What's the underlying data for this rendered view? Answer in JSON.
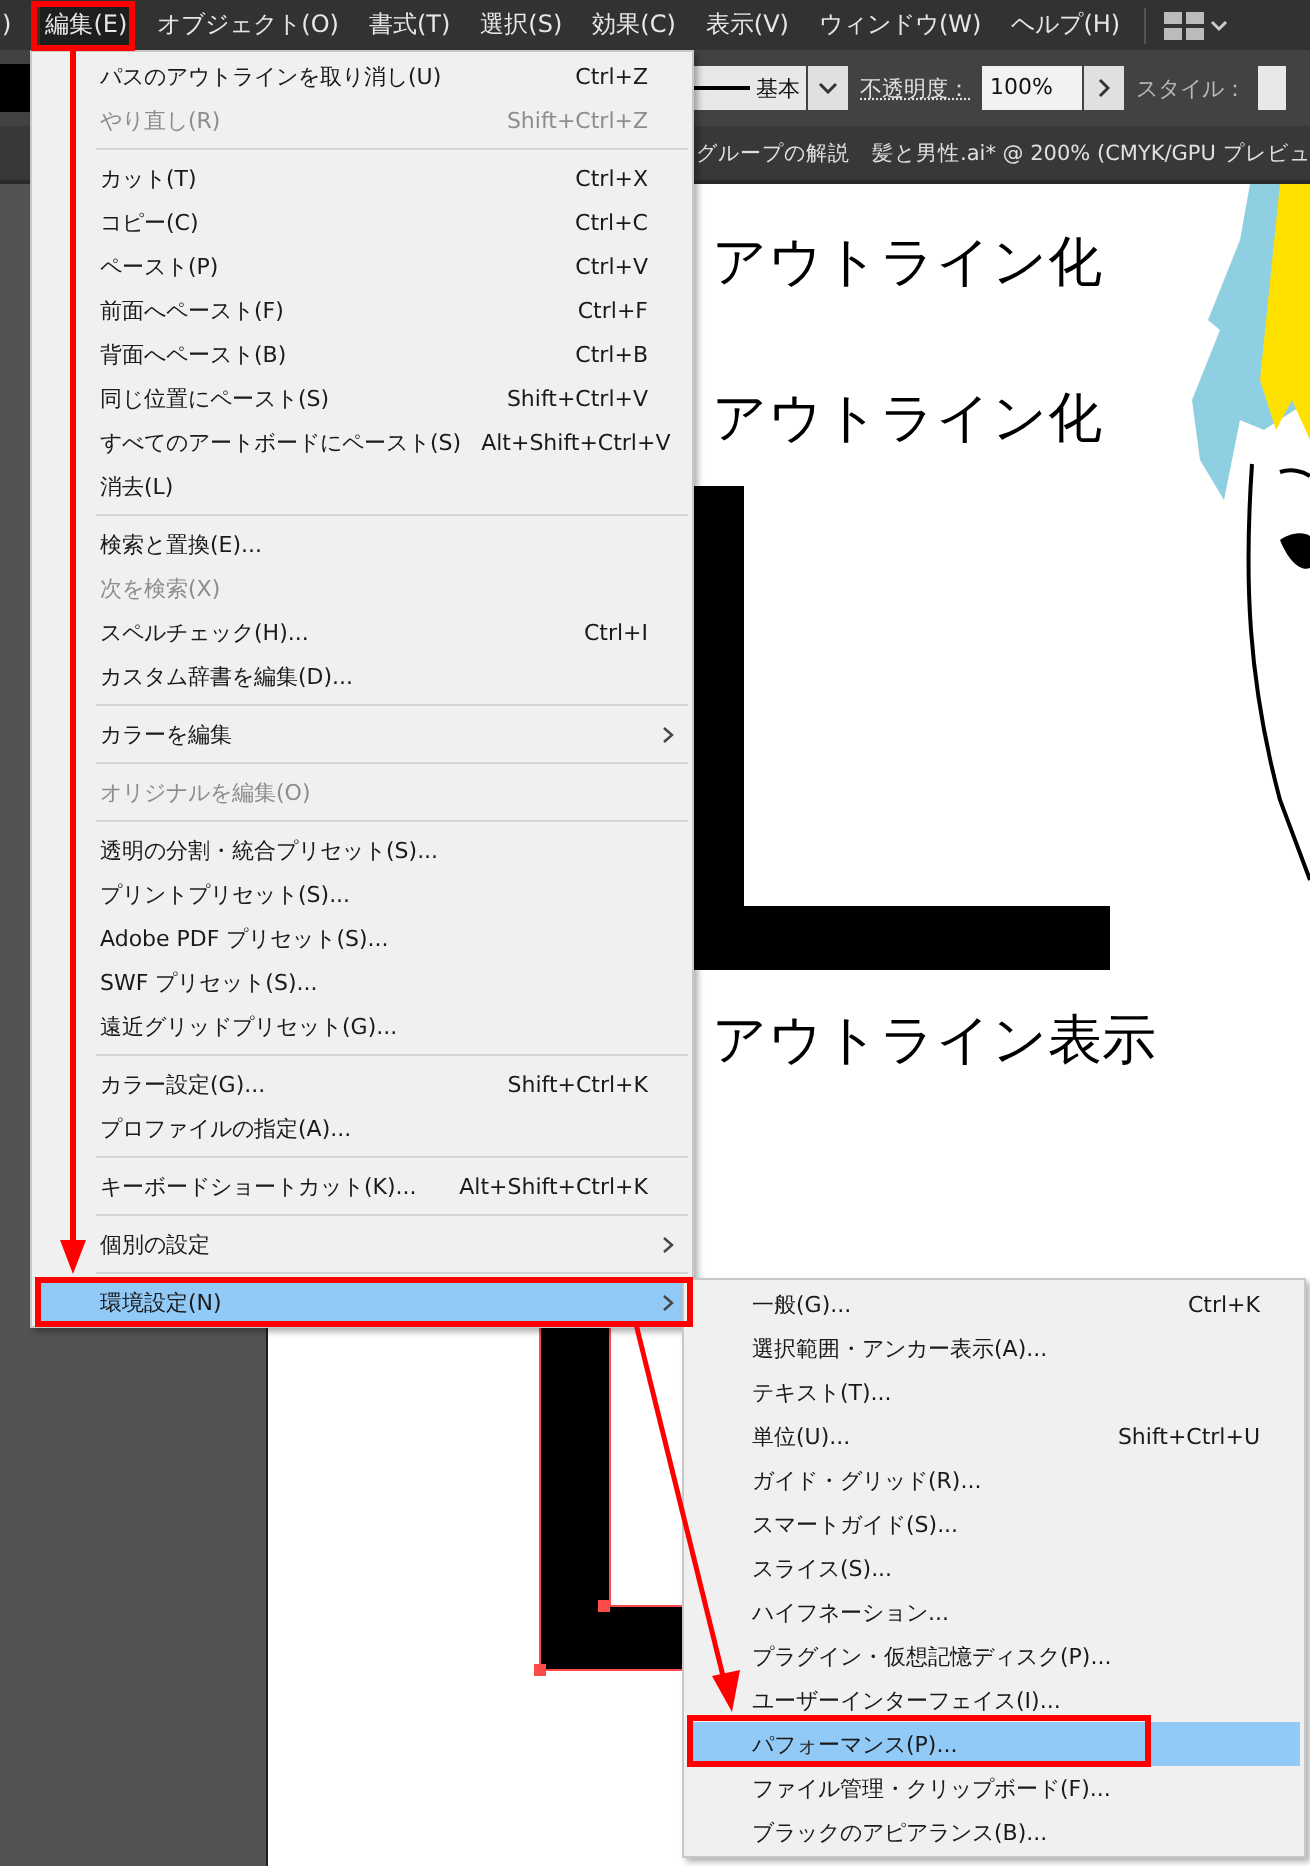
{
  "menu_bar": {
    "items": [
      {
        "label": ")",
        "selected": false
      },
      {
        "label": "編集(E)",
        "selected": true
      },
      {
        "label": "オブジェクト(O)",
        "selected": false
      },
      {
        "label": "書式(T)",
        "selected": false
      },
      {
        "label": "選択(S)",
        "selected": false
      },
      {
        "label": "効果(C)",
        "selected": false
      },
      {
        "label": "表示(V)",
        "selected": false
      },
      {
        "label": "ウィンドウ(W)",
        "selected": false
      },
      {
        "label": "ヘルプ(H)",
        "selected": false
      }
    ]
  },
  "control_bar": {
    "stroke_style": "基本",
    "opacity_label": "不透明度：",
    "opacity_value": "100%",
    "style_label": "スタイル："
  },
  "document_tab": {
    "title": "グループの解説　髪と男性.ai* @ 200% (CMYK/GPU プレビュ"
  },
  "canvas": {
    "texts": [
      "アウトライン化",
      "アウトライン化",
      "アウトライン表示"
    ]
  },
  "edit_menu": {
    "items": [
      {
        "kind": "item",
        "label": "パスのアウトラインを取り消し(U)",
        "shortcut": "Ctrl+Z",
        "disabled": false,
        "has_submenu": false,
        "selected": false
      },
      {
        "kind": "item",
        "label": "やり直し(R)",
        "shortcut": "Shift+Ctrl+Z",
        "disabled": true,
        "has_submenu": false,
        "selected": false
      },
      {
        "kind": "separator"
      },
      {
        "kind": "item",
        "label": "カット(T)",
        "shortcut": "Ctrl+X",
        "disabled": false,
        "has_submenu": false,
        "selected": false
      },
      {
        "kind": "item",
        "label": "コピー(C)",
        "shortcut": "Ctrl+C",
        "disabled": false,
        "has_submenu": false,
        "selected": false
      },
      {
        "kind": "item",
        "label": "ペースト(P)",
        "shortcut": "Ctrl+V",
        "disabled": false,
        "has_submenu": false,
        "selected": false
      },
      {
        "kind": "item",
        "label": "前面へペースト(F)",
        "shortcut": "Ctrl+F",
        "disabled": false,
        "has_submenu": false,
        "selected": false
      },
      {
        "kind": "item",
        "label": "背面へペースト(B)",
        "shortcut": "Ctrl+B",
        "disabled": false,
        "has_submenu": false,
        "selected": false
      },
      {
        "kind": "item",
        "label": "同じ位置にペースト(S)",
        "shortcut": "Shift+Ctrl+V",
        "disabled": false,
        "has_submenu": false,
        "selected": false
      },
      {
        "kind": "item",
        "label": "すべてのアートボードにペースト(S)",
        "shortcut": "Alt+Shift+Ctrl+V",
        "disabled": false,
        "has_submenu": false,
        "selected": false
      },
      {
        "kind": "item",
        "label": "消去(L)",
        "disabled": false,
        "has_submenu": false,
        "selected": false
      },
      {
        "kind": "separator"
      },
      {
        "kind": "item",
        "label": "検索と置換(E)...",
        "disabled": false,
        "has_submenu": false,
        "selected": false
      },
      {
        "kind": "item",
        "label": "次を検索(X)",
        "disabled": true,
        "has_submenu": false,
        "selected": false
      },
      {
        "kind": "item",
        "label": "スペルチェック(H)...",
        "shortcut": "Ctrl+I",
        "disabled": false,
        "has_submenu": false,
        "selected": false
      },
      {
        "kind": "item",
        "label": "カスタム辞書を編集(D)...",
        "disabled": false,
        "has_submenu": false,
        "selected": false
      },
      {
        "kind": "separator"
      },
      {
        "kind": "item",
        "label": "カラーを編集",
        "disabled": false,
        "has_submenu": true,
        "selected": false
      },
      {
        "kind": "separator"
      },
      {
        "kind": "item",
        "label": "オリジナルを編集(O)",
        "disabled": true,
        "has_submenu": false,
        "selected": false
      },
      {
        "kind": "separator"
      },
      {
        "kind": "item",
        "label": "透明の分割・統合プリセット(S)...",
        "disabled": false,
        "has_submenu": false,
        "selected": false
      },
      {
        "kind": "item",
        "label": "プリントプリセット(S)...",
        "disabled": false,
        "has_submenu": false,
        "selected": false
      },
      {
        "kind": "item",
        "label": "Adobe PDF プリセット(S)...",
        "disabled": false,
        "has_submenu": false,
        "selected": false
      },
      {
        "kind": "item",
        "label": "SWF プリセット(S)...",
        "disabled": false,
        "has_submenu": false,
        "selected": false
      },
      {
        "kind": "item",
        "label": "遠近グリッドプリセット(G)...",
        "disabled": false,
        "has_submenu": false,
        "selected": false
      },
      {
        "kind": "separator"
      },
      {
        "kind": "item",
        "label": "カラー設定(G)...",
        "shortcut": "Shift+Ctrl+K",
        "disabled": false,
        "has_submenu": false,
        "selected": false
      },
      {
        "kind": "item",
        "label": "プロファイルの指定(A)...",
        "disabled": false,
        "has_submenu": false,
        "selected": false
      },
      {
        "kind": "separator"
      },
      {
        "kind": "item",
        "label": "キーボードショートカット(K)...",
        "shortcut": "Alt+Shift+Ctrl+K",
        "disabled": false,
        "has_submenu": false,
        "selected": false
      },
      {
        "kind": "separator"
      },
      {
        "kind": "item",
        "label": "個別の設定",
        "disabled": false,
        "has_submenu": true,
        "selected": false
      },
      {
        "kind": "separator"
      },
      {
        "kind": "item",
        "label": "環境設定(N)",
        "disabled": false,
        "has_submenu": true,
        "selected": true
      }
    ]
  },
  "preferences_submenu": {
    "items": [
      {
        "kind": "item",
        "label": "一般(G)...",
        "shortcut": "Ctrl+K",
        "disabled": false,
        "has_submenu": false,
        "selected": false
      },
      {
        "kind": "item",
        "label": "選択範囲・アンカー表示(A)...",
        "disabled": false,
        "has_submenu": false,
        "selected": false
      },
      {
        "kind": "item",
        "label": "テキスト(T)...",
        "disabled": false,
        "has_submenu": false,
        "selected": false
      },
      {
        "kind": "item",
        "label": "単位(U)...",
        "shortcut": "Shift+Ctrl+U",
        "disabled": false,
        "has_submenu": false,
        "selected": false
      },
      {
        "kind": "item",
        "label": "ガイド・グリッド(R)...",
        "disabled": false,
        "has_submenu": false,
        "selected": false
      },
      {
        "kind": "item",
        "label": "スマートガイド(S)...",
        "disabled": false,
        "has_submenu": false,
        "selected": false
      },
      {
        "kind": "item",
        "label": "スライス(S)...",
        "disabled": false,
        "has_submenu": false,
        "selected": false
      },
      {
        "kind": "item",
        "label": "ハイフネーション...",
        "disabled": false,
        "has_submenu": false,
        "selected": false
      },
      {
        "kind": "item",
        "label": "プラグイン・仮想記憶ディスク(P)...",
        "disabled": false,
        "has_submenu": false,
        "selected": false
      },
      {
        "kind": "item",
        "label": "ユーザーインターフェイス(I)...",
        "disabled": false,
        "has_submenu": false,
        "selected": false
      },
      {
        "kind": "item",
        "label": "パフォーマンス(P)...",
        "disabled": false,
        "has_submenu": false,
        "selected": true
      },
      {
        "kind": "item",
        "label": "ファイル管理・クリップボード(F)...",
        "disabled": false,
        "has_submenu": false,
        "selected": false
      },
      {
        "kind": "item",
        "label": "ブラックのアピアランス(B)...",
        "disabled": false,
        "has_submenu": false,
        "selected": false
      }
    ]
  }
}
